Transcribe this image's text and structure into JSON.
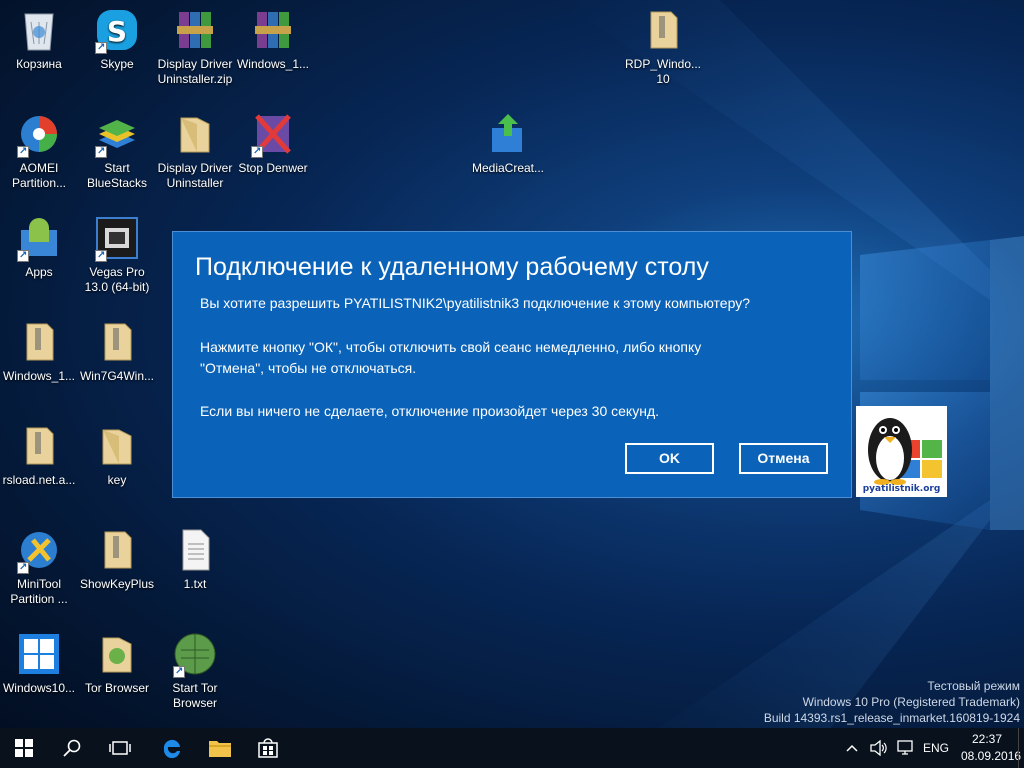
{
  "desktop": {
    "icons": {
      "recycle": "Корзина",
      "skype": "Skype",
      "ddu_zip": "Display Driver Uninstaller.zip",
      "windows1": "Windows_1...",
      "rdp": "RDP_Windo... 10",
      "aomei": "AOMEI Partition...",
      "bluestacks": "Start BlueStacks",
      "ddu": "Display Driver Uninstaller",
      "stop_denwer": "Stop Denwer",
      "mediacreat": "MediaCreat...",
      "apps": "Apps",
      "vegas": "Vegas Pro 13.0 (64-bit)",
      "windows1b": "Windows_1...",
      "win7g4": "Win7G4Win...",
      "rsload": "rsload.net.a...",
      "key": "key",
      "minitool": "MiniTool Partition ...",
      "showkeyplus": "ShowKeyPlus",
      "txt": "1.txt",
      "windows10": "Windows10...",
      "tor_browser": "Tor Browser",
      "start_tor": "Start Tor Browser"
    }
  },
  "dialog": {
    "title": "Подключение к удаленному рабочему столу",
    "question": "Вы хотите разрешить PYATILISTNIK2\\pyatilistnik3 подключение к этому компьютеру?",
    "instruction_line1": "Нажмите кнопку \"ОК\", чтобы отключить свой сеанс немедленно, либо кнопку",
    "instruction_line2": "\"Отмена\", чтобы не отключаться.",
    "timeout": "Если вы ничего не сделаете, отключение произойдет через 30 секунд.",
    "ok_label": "OK",
    "cancel_label": "Отмена"
  },
  "logo": {
    "caption": "pyatilistnik.org"
  },
  "watermark": {
    "line1": "Тестовый режим",
    "line2": "Windows 10 Pro (Registered Trademark)",
    "line3": "Build 14393.rs1_release_inmarket.160819-1924"
  },
  "taskbar": {
    "language": "ENG",
    "time": "22:37",
    "date": "08.09.2016"
  },
  "colors": {
    "dialog_bg": "#0a63b8",
    "taskbar_bg": "#08111c",
    "accent": "#0078d7"
  }
}
